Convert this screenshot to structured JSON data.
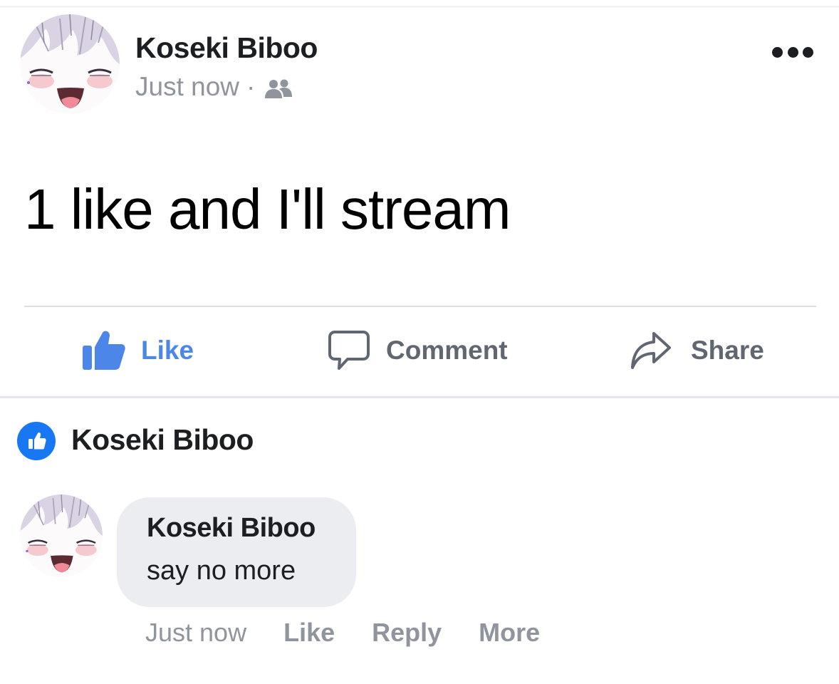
{
  "post": {
    "author": "Koseki Biboo",
    "timestamp": "Just now",
    "separator": "·",
    "audience_icon": "friends-icon",
    "menu_icon": "more-horizontal-icon",
    "text": "1 like and I'll stream"
  },
  "actions": {
    "like_label": "Like",
    "comment_label": "Comment",
    "share_label": "Share",
    "like_color": "#4b86e8",
    "neutral_color": "#606770"
  },
  "reactions": {
    "icon": "thumbs-up-icon",
    "name": "Koseki Biboo",
    "badge_color": "#1877f2"
  },
  "comment": {
    "author": "Koseki Biboo",
    "text": "say no more",
    "timestamp": "Just now",
    "like_label": "Like",
    "reply_label": "Reply",
    "more_label": "More"
  }
}
